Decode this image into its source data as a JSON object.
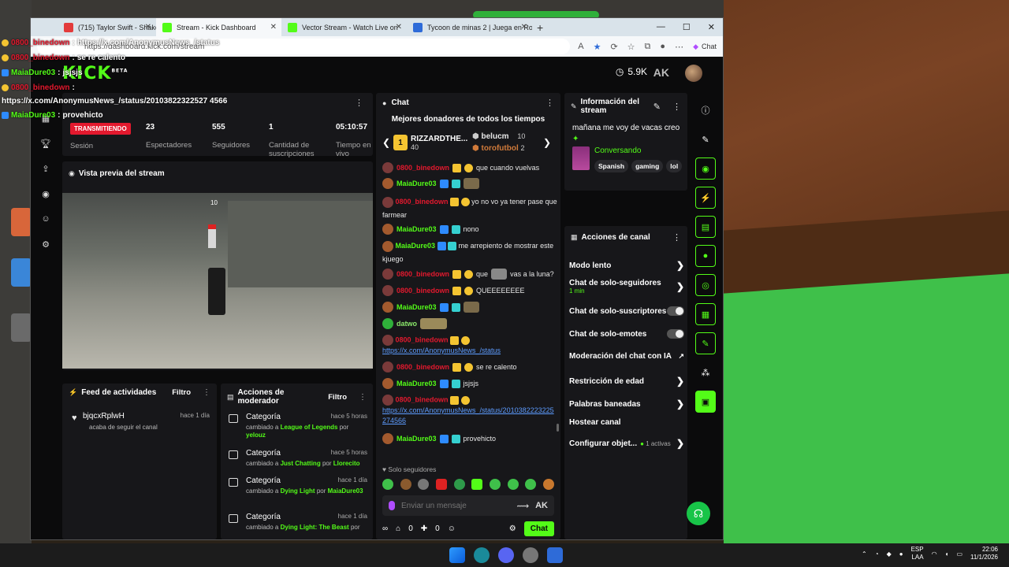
{
  "browser": {
    "tabs": [
      {
        "label": "(715) Taylor Swift - Shake It Of",
        "color": "#e33b3b"
      },
      {
        "label": "Stream - Kick Dashboard",
        "color": "#53fc18"
      },
      {
        "label": "Vector Stream - Watch Live on",
        "color": "#53fc18"
      },
      {
        "label": "Tycoon de minas 2 | Juega en Rob",
        "color": "#2e6bd8"
      }
    ],
    "url": "https://dashboard.kick.com/stream",
    "chat_button": "Chat"
  },
  "overlay_chat": [
    {
      "user": "0800_binedown",
      "text": "https://x.com/AnonymusNews_/status",
      "user_color": "red"
    },
    {
      "user": "0800_binedown",
      "text": "se re calento",
      "user_color": "red"
    },
    {
      "user": "MaiaDure03",
      "text": "jsjsjs",
      "user_color": "green"
    },
    {
      "user": "0800_binedown",
      "text": "",
      "user_color": "red"
    },
    {
      "user": "",
      "text": "https://x.com/AnonymusNews_/status/20103822322527 4566",
      "user_color": "white"
    },
    {
      "user": "MaiaDure03",
      "text": "provehicto",
      "user_color": "green"
    }
  ],
  "kick": {
    "logo": "KICK",
    "beta": "BETA",
    "followers_short": "5.9K",
    "session": {
      "badge": "TRANSMITIENDO",
      "label": "Sesión",
      "stats": [
        {
          "value": "23",
          "label": "Espectadores"
        },
        {
          "value": "555",
          "label": "Seguidores"
        },
        {
          "value": "1",
          "label": "Cantidad de suscripciones"
        },
        {
          "value": "05:10:57",
          "label": "Tiempo en vivo"
        }
      ]
    },
    "preview": {
      "title": "Vista previa del stream",
      "hud_value": "10"
    },
    "feed": {
      "title": "Feed de actividades",
      "filter": "Filtro",
      "items": [
        {
          "name": "bjqcxRplwH",
          "desc": "acaba de seguir el canal",
          "time": "hace 1 día"
        }
      ]
    },
    "moderator": {
      "title": "Acciones de moderador",
      "filter": "Filtro",
      "items": [
        {
          "cat": "Categoría",
          "time": "hace 5 horas",
          "pre": "cambiado a",
          "game": "League of Legends",
          "by": "por",
          "user": "yelouz"
        },
        {
          "cat": "Categoría",
          "time": "hace 5 horas",
          "pre": "cambiado a",
          "game": "Just Chatting",
          "by": "por",
          "user": "Llorecito"
        },
        {
          "cat": "Categoría",
          "time": "hace 1 día",
          "pre": "cambiado a",
          "game": "Dying Light",
          "by": "por",
          "user": "MaiaDure03"
        },
        {
          "cat": "Categoría",
          "time": "hace 1 día",
          "pre": "cambiado a",
          "game": "Dying Light: The Beast",
          "by": "por",
          "user": ""
        }
      ]
    },
    "chat": {
      "title": "Chat",
      "donors_title": "Mejores donadores de todos los tiempos",
      "donors": [
        {
          "rank": "1",
          "name": "RIZZARDTHE...",
          "amount": "40"
        },
        {
          "rank": "2",
          "name": "belucm",
          "amount": "10"
        },
        {
          "rank": "3",
          "name": "torofutbol",
          "amount": "2"
        }
      ],
      "messages": [
        {
          "user": "0800_binedown",
          "text": "que cuando vuelvas",
          "kind": "red"
        },
        {
          "user": "MaiaDure03",
          "text": "",
          "kind": "green"
        },
        {
          "user": "0800_binedown",
          "text": "yo no vo ya tener pase que farmear",
          "kind": "red"
        },
        {
          "user": "MaiaDure03",
          "text": "nono",
          "kind": "green"
        },
        {
          "user": "MaiaDure03",
          "text": "me arrepiento de mostrar este kjuego",
          "kind": "green"
        },
        {
          "user": "0800_binedown",
          "text": "que",
          "extra": "vas a la luna?",
          "kind": "red"
        },
        {
          "user": "0800_binedown",
          "text": "QUEEEEEEEE",
          "kind": "red"
        },
        {
          "user": "MaiaDure03",
          "text": "",
          "kind": "green"
        },
        {
          "user": "datwo",
          "text": "",
          "kind": "green"
        },
        {
          "user": "0800_binedown",
          "text": "https://x.com/AnonymusNews_/status",
          "kind": "red-link"
        },
        {
          "user": "0800_binedown",
          "text": "se re calento",
          "kind": "red"
        },
        {
          "user": "MaiaDure03",
          "text": "jsjsjs",
          "kind": "green"
        },
        {
          "user": "0800_binedown",
          "text": "https://x.com/AnonymusNews_/status/2010382223225274566",
          "kind": "red-link"
        },
        {
          "user": "MaiaDure03",
          "text": "provehicto",
          "kind": "green"
        }
      ],
      "solo": "Solo seguidores",
      "placeholder": "Enviar un mensaje",
      "count1": "0",
      "count2": "0",
      "send": "Chat"
    },
    "info": {
      "title": "Información del stream",
      "desc": "mañana me voy de vacas creo",
      "category": "Conversando",
      "tags": [
        "Spanish",
        "gaming",
        "lol"
      ]
    },
    "actions": {
      "title": "Acciones de canal",
      "items": [
        {
          "label": "Modo lento",
          "type": "chevron"
        },
        {
          "label": "Chat de solo-seguidores",
          "sub": "1 min",
          "type": "chevron"
        },
        {
          "label": "Chat de solo-suscriptores",
          "type": "toggle"
        },
        {
          "label": "Chat de solo-emotes",
          "type": "toggle"
        },
        {
          "label": "Moderación del chat con IA",
          "type": "external"
        },
        {
          "label": "Restricción de edad",
          "type": "chevron"
        },
        {
          "label": "Palabras baneadas",
          "type": "chevron"
        },
        {
          "label": "Hostear canal",
          "type": "none"
        },
        {
          "label": "Configurar objet...",
          "extra": "1 activas",
          "type": "chevron"
        }
      ]
    }
  },
  "taskbar": {
    "lang": "ESP",
    "lang2": "LAA",
    "time": "22:06",
    "date": "11/1/2026"
  }
}
